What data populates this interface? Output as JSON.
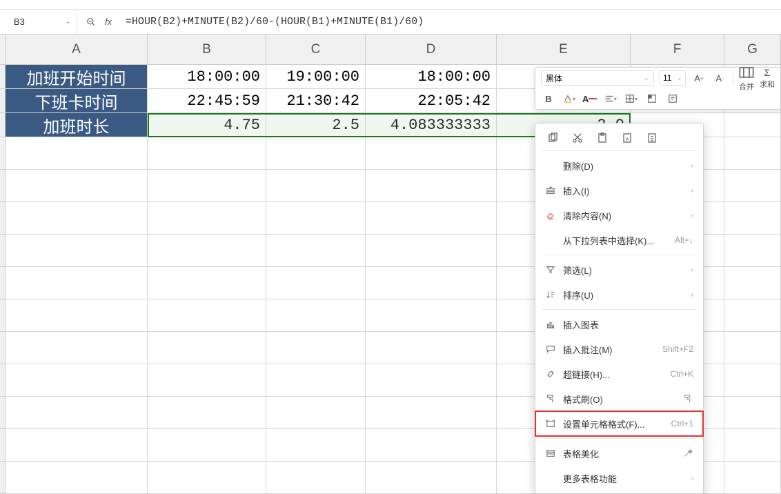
{
  "namebox": {
    "ref": "B3"
  },
  "formula": "=HOUR(B2)+MINUTE(B2)/60-(HOUR(B1)+MINUTE(B1)/60)",
  "columns": [
    "A",
    "B",
    "C",
    "D",
    "E",
    "F",
    "G"
  ],
  "rows": [
    {
      "header": "加班开始时间",
      "cells": [
        "18:00:00",
        "19:00:00",
        "18:00:00",
        ""
      ]
    },
    {
      "header": "下班卡时间",
      "cells": [
        "22:45:59",
        "21:30:42",
        "22:05:42",
        ""
      ]
    },
    {
      "header": "加班时长",
      "cells": [
        "4.75",
        "2.5",
        "4.083333333",
        "3.0"
      ]
    }
  ],
  "selection": {
    "range": "B3:E3"
  },
  "miniToolbar": {
    "font": "黑体",
    "size": "11",
    "increaseFont": "A",
    "decreaseFont": "A",
    "bold": "B",
    "mergeLabel": "合并",
    "sumLabel": "求和"
  },
  "contextMenu": {
    "delete": {
      "label": "删除(D)"
    },
    "insert": {
      "label": "插入(I)"
    },
    "clear": {
      "label": "清除内容(N)"
    },
    "dropdown": {
      "label": "从下拉列表中选择(K)...",
      "kb": "Alt+↓"
    },
    "filter": {
      "label": "筛选(L)"
    },
    "sort": {
      "label": "排序(U)"
    },
    "insertChart": {
      "label": "插入图表"
    },
    "comment": {
      "label": "插入批注(M)",
      "kb": "Shift+F2"
    },
    "hyperlink": {
      "label": "超链接(H)...",
      "kb": "Ctrl+K"
    },
    "formatPaint": {
      "label": "格式刷(O)"
    },
    "cellFormat": {
      "label": "设置单元格格式(F)...",
      "kb": "Ctrl+1"
    },
    "tableStyle": {
      "label": "表格美化"
    },
    "moreTable": {
      "label": "更多表格功能"
    }
  }
}
